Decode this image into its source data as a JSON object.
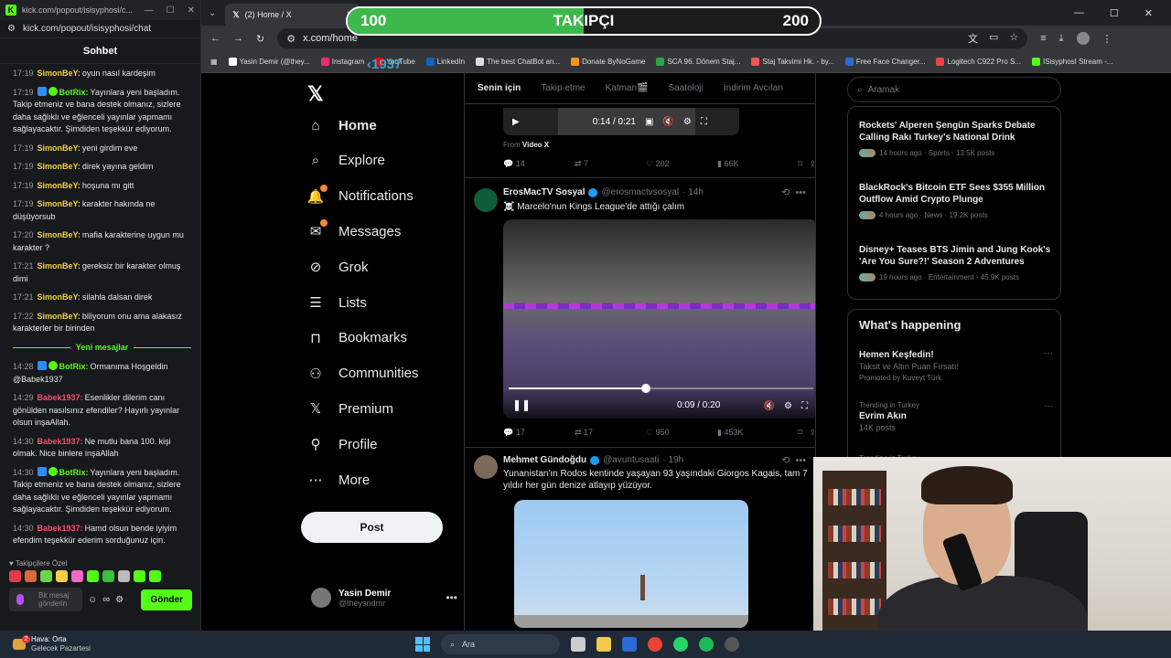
{
  "chat": {
    "window_url": "kick.com/popout/isisyphosi/c...",
    "url": "kick.com/popout/isisyphosi/chat",
    "title": "Sohbet",
    "messages_old": [
      {
        "time": "17:19",
        "user": "SimonBeY:",
        "text": "oyun nasıl kardeşim",
        "kind": "simon"
      },
      {
        "time": "17:19",
        "user": "BotRix:",
        "text": "Yayınlara yeni başladım. Takip etmeniz ve bana destek olmanız, sizlere daha sağlıklı ve eğlenceli yayınlar yapmamı sağlayacaktır. Şimdiden teşekkür ediyorum.",
        "kind": "bot"
      },
      {
        "time": "17:19",
        "user": "SimonBeY:",
        "text": "yeni girdim eve",
        "kind": "simon"
      },
      {
        "time": "17:19",
        "user": "SimonBeY:",
        "text": "direk yayına geldim",
        "kind": "simon"
      },
      {
        "time": "17:19",
        "user": "SimonBeY:",
        "text": "hoşuna mı gitt",
        "kind": "simon"
      },
      {
        "time": "17:19",
        "user": "SimonBeY:",
        "text": "karakter hakında ne düşüyorsub",
        "kind": "simon"
      },
      {
        "time": "17:20",
        "user": "SimonBeY:",
        "text": "mafia karakterine uygun mu karakter ?",
        "kind": "simon"
      },
      {
        "time": "17:21",
        "user": "SimonBeY:",
        "text": "gereksiz bir karakter olmuş dimi",
        "kind": "simon"
      },
      {
        "time": "17:21",
        "user": "SimonBeY:",
        "text": "silahla dalsan direk",
        "kind": "simon"
      },
      {
        "time": "17:22",
        "user": "SimonBeY:",
        "text": "biliyorum onu ama alakasız karakterler bir birinden",
        "kind": "simon"
      }
    ],
    "new_messages_label": "Yeni mesajlar",
    "messages_new": [
      {
        "time": "14:28",
        "user": "BotRix:",
        "text": "Ormanıma Hoşgeldin @Babek1937",
        "kind": "bot"
      },
      {
        "time": "14:29",
        "user": "Babek1937:",
        "text": "Esenlikler dilerim canı gönülden nasılsınız efendiler? Hayırlı yayınlar olsun inşaAllah.",
        "kind": "babek"
      },
      {
        "time": "14:30",
        "user": "Babek1937:",
        "text": "Ne mutlu bana 100. kişi olmak. Nice binlere inşaAllah",
        "kind": "babek"
      },
      {
        "time": "14:30",
        "user": "BotRix:",
        "text": "Yayınlara yeni başladım. Takip etmeniz ve bana destek olmanız, sizlere daha sağlıklı ve eğlenceli yayınlar yapmamı sağlayacaktır. Şimdiden teşekkür ediyorum.",
        "kind": "bot"
      },
      {
        "time": "14:30",
        "user": "Babek1937:",
        "text": "Hamd olsun bende iyiyim efendim teşekkür ederim sorduğunuz için.",
        "kind": "babek"
      }
    ],
    "followers_only_label": "Takipçilere Özel",
    "input_placeholder": "Bir mesaj gönderin",
    "send_label": "Gönder"
  },
  "browser": {
    "tab_title": "(2) Home / X",
    "url": "x.com/home",
    "bookmarks": [
      "Yasin Demir (@they...",
      "Instagram",
      "YouTube",
      "LinkedIn",
      "The best ChatBot an...",
      "Donate ByNoGame",
      "SCA 96. Dönem Staj...",
      "Staj Takvimi Hk. - by...",
      "Free Face Changer...",
      "Logitech C922 Pro S...",
      "ISisyphosI Stream -..."
    ]
  },
  "goal": {
    "left": "100",
    "center": "TAKIPÇI",
    "right": "200",
    "progress": 0.5
  },
  "overlay_name": "‹1937",
  "x": {
    "nav": [
      "Home",
      "Explore",
      "Notifications",
      "Messages",
      "Grok",
      "Lists",
      "Bookmarks",
      "Communities",
      "Premium",
      "Profile",
      "More"
    ],
    "post_label": "Post",
    "me_name": "Yasin Demir",
    "me_handle": "@theysndmr",
    "tabs": [
      "Senin için",
      "Takip etme",
      "Katman🎬",
      "Saatoloji",
      "İndirim Avcıları"
    ],
    "top_video_time": "0:14 / 0:21",
    "from_label": "From",
    "from_source": "Video X",
    "top_actions": [
      "14",
      "7",
      "202",
      "66K"
    ],
    "tweet1": {
      "name": "ErosMacTV Sosyal",
      "handle": "@erosmactvsosyal",
      "ago": "· 14h",
      "text": "☠️ Marcelo'nun Kings League'de attığı çalım",
      "video_time": "0:09 / 0:20",
      "video_progress": 0.45,
      "actions": [
        "17",
        "17",
        "950",
        "453K"
      ]
    },
    "tweet2": {
      "name": "Mehmet Gündoğdu",
      "handle": "@avuntusaati",
      "ago": "· 19h",
      "text": "Yunanistan'ın Rodos kentinde yaşayan 93 yaşındaki Giorgos Kagais, tam 7 yıldır her gün denize atlayıp yüzüyor."
    },
    "search_placeholder": "Aramak",
    "news": [
      {
        "title": "Rockets' Alperen Şengün Sparks Debate Calling Rakı Turkey's National Drink",
        "meta": "14 hours ago · Sports · 13.5K posts"
      },
      {
        "title": "BlackRock's Bitcoin ETF Sees $355 Million Outflow Amid Crypto Plunge",
        "meta": "4 hours ago · News · 19.2K posts"
      },
      {
        "title": "Disney+ Teases BTS Jimin and Jung Kook's 'Are You Sure?!' Season 2 Adventures",
        "meta": "19 hours ago · Entertainment · 45.9K posts"
      }
    ],
    "whats_happening": "What's happening",
    "trends": [
      {
        "small": "",
        "title": "Hemen Keşfedin!",
        "desc": "Taksit ve Altın Puan Fırsatı!",
        "extra": "Promoted by Kuveyt Türk"
      },
      {
        "small": "Trending in Turkey",
        "title": "Evrim Akın",
        "desc": "14K posts",
        "extra": ""
      },
      {
        "small": "Trending in Turkey",
        "title": "",
        "desc": "",
        "extra": ""
      }
    ]
  },
  "taskbar": {
    "weather_title": "Hava: Orta",
    "weather_sub": "Gelecek Pazartesi",
    "search_placeholder": "Ara"
  }
}
